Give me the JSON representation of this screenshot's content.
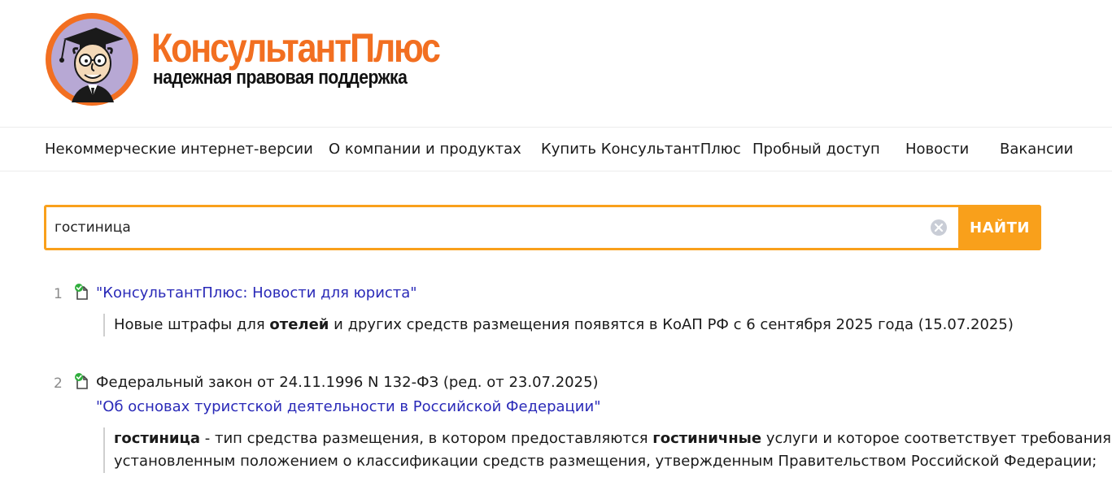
{
  "header": {
    "brand_part1": "Консультант",
    "brand_part2": "Плюс",
    "tagline": "надежная правовая поддержка",
    "brand_color": "#f26f21",
    "logo_icon": "professor-mascot-icon"
  },
  "nav": {
    "items": [
      {
        "label": "Некоммерческие интернет-версии"
      },
      {
        "label": "О компании и продуктах"
      },
      {
        "label": "Купить КонсультантПлюс"
      },
      {
        "label": "Пробный доступ"
      },
      {
        "label": "Новости"
      },
      {
        "label": "Вакансии"
      }
    ]
  },
  "search": {
    "value": "гостиница",
    "placeholder": "",
    "button_label": "НАЙТИ",
    "accent_color": "#f9a01b"
  },
  "results": [
    {
      "number": "1",
      "link": "\"КонсультантПлюс: Новости для юриста\"",
      "snippet": {
        "pre": "Новые штрафы для ",
        "bold": "отелей",
        "post": " и других средств размещения появятся в КоАП РФ с 6 сентября 2025 года (15.07.2025)"
      }
    },
    {
      "number": "2",
      "title": "Федеральный закон от 24.11.1996 N 132-ФЗ (ред. от 23.07.2025)",
      "link": "\"Об основах туристской деятельности в Российской Федерации\"",
      "snippet": {
        "bold1": "гостиница",
        "mid1": " - тип средства размещения, в котором предоставляются ",
        "bold2": "гостиничные",
        "mid2": " услуги и которое соответствует требованиям,",
        "line2": "установленным положением о классификации средств размещения, утвержденным Правительством Российской Федерации;"
      }
    }
  ],
  "colors": {
    "link": "#2a2ab8",
    "status_ok": "#2fae3c"
  }
}
